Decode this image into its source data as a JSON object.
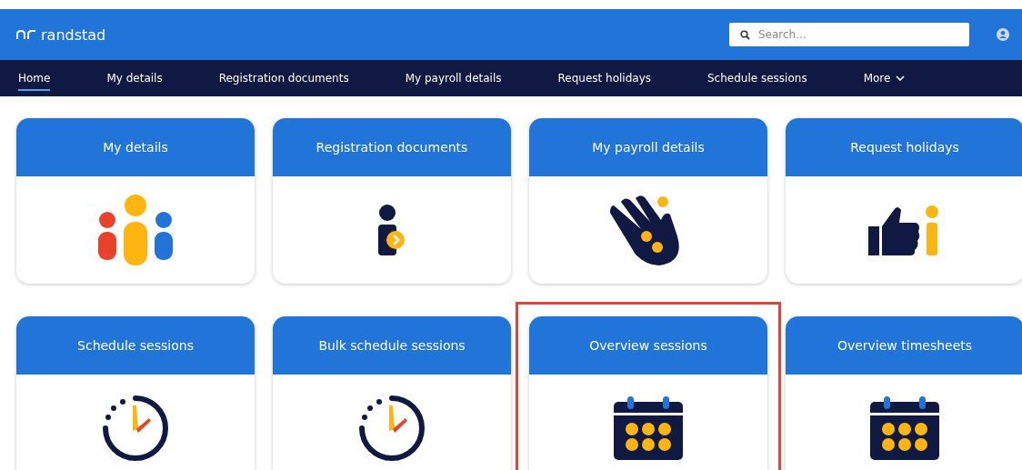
{
  "header": {
    "logo": "randstad",
    "search": {
      "placeholder": "Search..."
    }
  },
  "nav": [
    {
      "label": "Home",
      "selected": true
    },
    {
      "label": "My details",
      "selected": false
    },
    {
      "label": "Registration documents",
      "selected": false
    },
    {
      "label": "My payroll details",
      "selected": false
    },
    {
      "label": "Request holidays",
      "selected": false
    },
    {
      "label": "Schedule sessions",
      "selected": false
    },
    {
      "label": "More",
      "selected": false,
      "kind": "dropdown"
    }
  ],
  "tiles": [
    {
      "title": "My details",
      "kind": "people",
      "highlighted": false
    },
    {
      "title": "Registration documents",
      "kind": "person-badge",
      "highlighted": false
    },
    {
      "title": "My payroll details",
      "kind": "hand",
      "highlighted": false
    },
    {
      "title": "Request holidays",
      "kind": "thumbs-up",
      "highlighted": false
    },
    {
      "title": "Schedule sessions",
      "kind": "clock",
      "highlighted": false
    },
    {
      "title": "Bulk schedule sessions",
      "kind": "clock",
      "highlighted": false
    },
    {
      "title": "Overview sessions",
      "kind": "calendar",
      "highlighted": true
    },
    {
      "title": "Overview timesheets",
      "kind": "calendar",
      "highlighted": false
    }
  ]
}
